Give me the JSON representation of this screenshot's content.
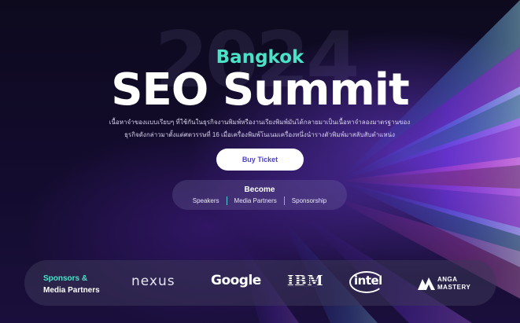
{
  "hero": {
    "year_watermark": "2024",
    "city": "Bangkok",
    "title": "SEO Summit",
    "description_line1": "เนื้อหาจำของแบบเรียบๆ ที่ใช้กันในธุรกิจงานพิมพ์หรืองานเรียงพิมพ์มันได้กลายมาเป็นเนื้อหาจำลองมาตรฐานของ",
    "description_line2": "ธุรกิจดังกล่าวมาตั้งแต่ศตวรรษที่ 16 เมื่อเครื่องพิมพ์โนเนมเครื่องหนึ่งนำรางตัวพิมพ์มาสลับสับตำแหน่ง",
    "buy_label": "Buy Ticket"
  },
  "become": {
    "title": "Become",
    "links": [
      "Speakers",
      "Media Partners",
      "Sponsorship"
    ]
  },
  "partners": {
    "label_line1": "Sponsors &",
    "label_line2": "Media Partners",
    "logos": {
      "nexus": "nexus",
      "google": "Google",
      "ibm": "IBM",
      "intel": "intel",
      "anga_line1": "ANGA",
      "anga_line2": "MASTERY"
    }
  },
  "colors": {
    "accent_teal": "#4be3c8",
    "button_text": "#4b3fd1",
    "background": "#120b2b"
  }
}
